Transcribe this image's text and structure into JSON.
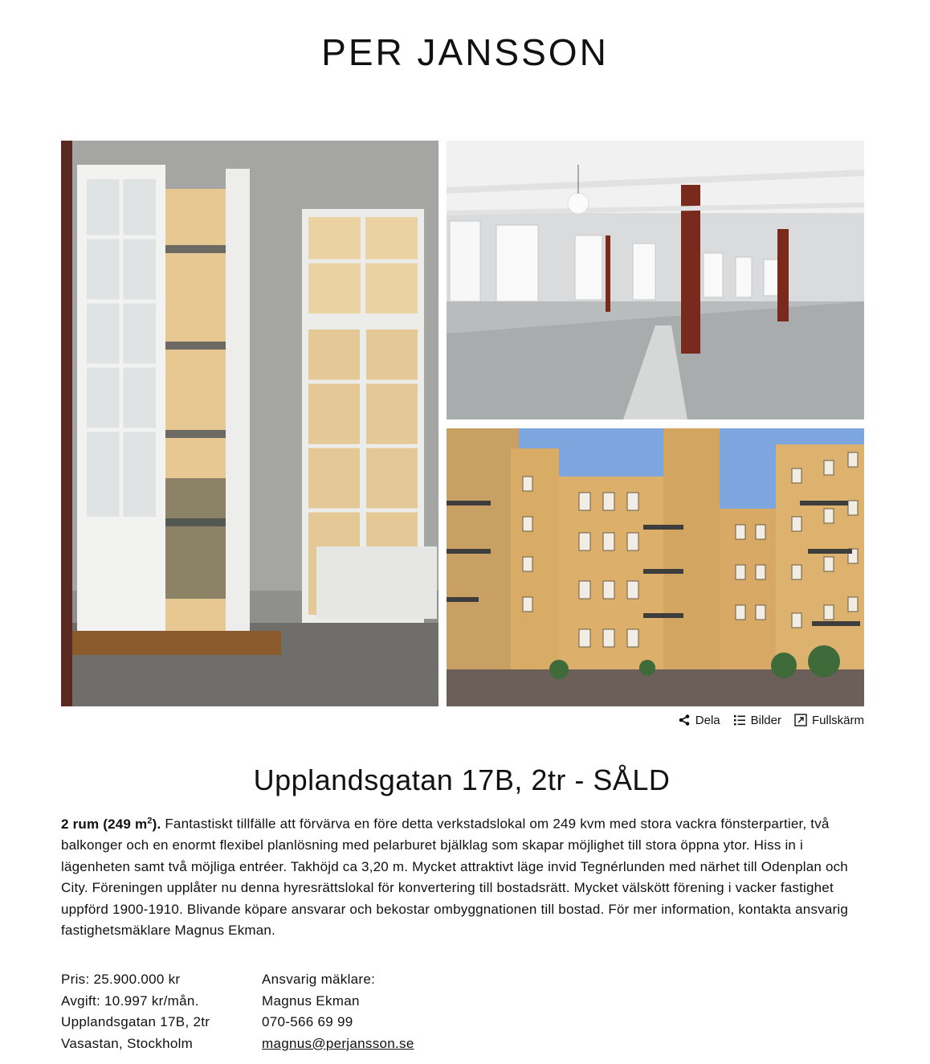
{
  "header": {
    "logo_text": "PER JANSSON"
  },
  "gallery": {
    "images": [
      {
        "alt": "Balkongdörr och fönster"
      },
      {
        "alt": "Öppen verkstadslokal"
      },
      {
        "alt": "Innergård med gul fasad"
      }
    ]
  },
  "toolbar": {
    "share_label": "Dela",
    "images_label": "Bilder",
    "fullscreen_label": "Fullskärm"
  },
  "listing": {
    "title": "Upplandsgatan 17B, 2tr - SÅLD",
    "summary_prefix": "2 rum (249 m",
    "summary_sup": "2",
    "summary_suffix": ").",
    "description": "Fantastiskt tillfälle att förvärva en före detta verkstadslokal om 249 kvm med stora vackra fönsterpartier, två balkonger och en enormt flexibel planlösning med pelarburet bjälklag som skapar möjlighet till stora öppna ytor. Hiss in i lägenheten samt två möjliga entréer. Takhöjd ca 3,20 m. Mycket attraktivt läge invid Tegnérlunden med närhet till Odenplan och City. Föreningen upplåter nu denna hyresrättslokal för konvertering till bostadsrätt. Mycket välskött förening i vacker fastighet uppförd 1900-1910. Blivande köpare ansvarar och bekostar ombyggnationen till bostad. För mer information, kontakta ansvarig fastighetsmäklare Magnus Ekman."
  },
  "facts": {
    "price": "Pris: 25.900.000 kr",
    "fee": "Avgift: 10.997 kr/mån.",
    "address": "Upplandsgatan 17B, 2tr",
    "area": "Vasastan, Stockholm"
  },
  "agent": {
    "heading": "Ansvarig mäklare:",
    "name": "Magnus Ekman",
    "phone": "070-566 69 99",
    "email": "magnus@perjansson.se"
  }
}
